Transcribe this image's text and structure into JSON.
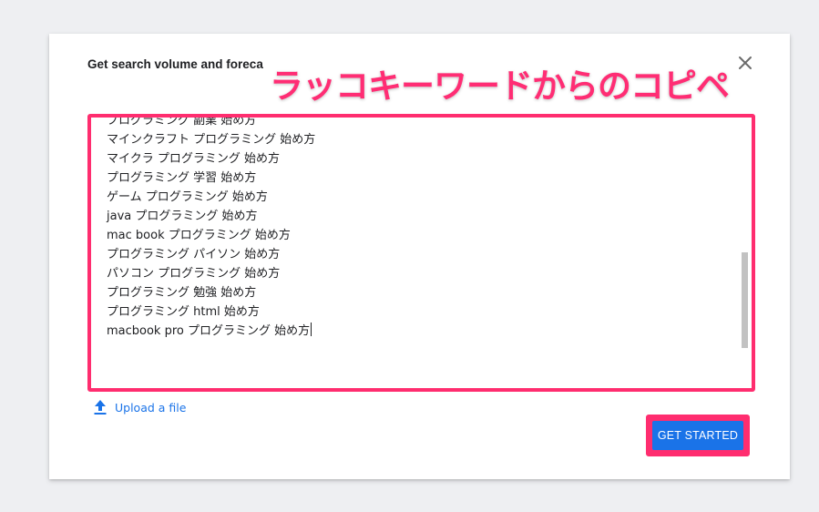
{
  "dialog": {
    "title": "Get search volume and foreca",
    "annotation": "ラッコキーワードからのコピペ",
    "keywords": [
      "プログラミング 副業 始め方",
      "マインクラフト プログラミング 始め方",
      "マイクラ プログラミング 始め方",
      "プログラミング 学習 始め方",
      "ゲーム プログラミング 始め方",
      "java プログラミング 始め方",
      "mac book プログラミング 始め方",
      "プログラミング パイソン 始め方",
      "パソコン プログラミング 始め方",
      "プログラミング 勉強 始め方",
      "プログラミング html 始め方",
      "macbook pro プログラミング 始め方"
    ],
    "upload_label": "Upload a file",
    "cta_label": "GET STARTED"
  },
  "icons": {
    "close": "close-icon",
    "upload": "upload-icon"
  },
  "colors": {
    "accent": "#1a73e8",
    "highlight": "#ff2d6f",
    "annotation": "#ff2d74",
    "background": "#eeeff2"
  }
}
